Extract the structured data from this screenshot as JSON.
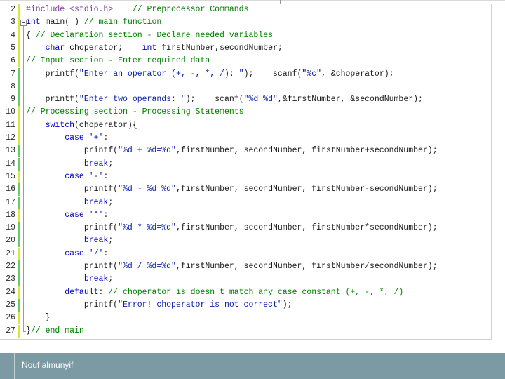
{
  "editor": {
    "lines": [
      {
        "number": "2",
        "gutter": "#d9e63a",
        "tokens": [
          {
            "t": "#include <stdio.h>",
            "c": "pp"
          },
          {
            "t": "    // Preprocessor Commands",
            "c": "cm"
          }
        ]
      },
      {
        "number": "3",
        "gutter": "#d9e63a",
        "tokens": [
          {
            "t": "int",
            "c": "kw"
          },
          {
            "t": " main( ) ",
            "c": "default"
          },
          {
            "t": "// main function",
            "c": "cm"
          }
        ]
      },
      {
        "number": "4",
        "gutter": "#d9e63a",
        "tokens": [
          {
            "t": "{ ",
            "c": "default"
          },
          {
            "t": "// Declaration section - Declare needed variables",
            "c": "cm"
          }
        ]
      },
      {
        "number": "5",
        "gutter": "#d9e63a",
        "tokens": [
          {
            "t": "    ",
            "c": "default"
          },
          {
            "t": "char",
            "c": "kw"
          },
          {
            "t": " choperator;    ",
            "c": "default"
          },
          {
            "t": "int",
            "c": "kw"
          },
          {
            "t": " firstNumber,secondNumber;",
            "c": "default"
          }
        ]
      },
      {
        "number": "6",
        "gutter": "#d9e63a",
        "tokens": [
          {
            "t": "// Input section - Enter required data",
            "c": "cm"
          }
        ]
      },
      {
        "number": "7",
        "gutter": "#66cc66",
        "tokens": [
          {
            "t": "    printf(",
            "c": "default"
          },
          {
            "t": "\"Enter an operator (+, -, *, /): \"",
            "c": "str"
          },
          {
            "t": ");    scanf(",
            "c": "default"
          },
          {
            "t": "\"%c\"",
            "c": "str"
          },
          {
            "t": ", &choperator);",
            "c": "default"
          }
        ]
      },
      {
        "number": "8",
        "gutter": "#66cc66",
        "tokens": []
      },
      {
        "number": "9",
        "gutter": "#66cc66",
        "tokens": [
          {
            "t": "    printf(",
            "c": "default"
          },
          {
            "t": "\"Enter two operands: \"",
            "c": "str"
          },
          {
            "t": ");    scanf(",
            "c": "default"
          },
          {
            "t": "\"%d %d\"",
            "c": "str"
          },
          {
            "t": ",&firstNumber, &secondNumber);",
            "c": "default"
          }
        ]
      },
      {
        "number": "10",
        "gutter": "#d9e63a",
        "tokens": [
          {
            "t": "// Processing section - Processing Statements",
            "c": "cm"
          }
        ]
      },
      {
        "number": "11",
        "gutter": "#d9e63a",
        "tokens": [
          {
            "t": "    ",
            "c": "default"
          },
          {
            "t": "switch",
            "c": "kw"
          },
          {
            "t": "(choperator){",
            "c": "default"
          }
        ]
      },
      {
        "number": "12",
        "gutter": "#d9e63a",
        "tokens": [
          {
            "t": "        ",
            "c": "default"
          },
          {
            "t": "case",
            "c": "kw"
          },
          {
            "t": " ",
            "c": "default"
          },
          {
            "t": "'+'",
            "c": "str"
          },
          {
            "t": ":",
            "c": "default"
          }
        ]
      },
      {
        "number": "13",
        "gutter": "#66cc66",
        "tokens": [
          {
            "t": "            printf(",
            "c": "default"
          },
          {
            "t": "\"%d + %d=%d\"",
            "c": "str"
          },
          {
            "t": ",firstNumber, secondNumber, firstNumber+secondNumber);",
            "c": "default"
          }
        ]
      },
      {
        "number": "14",
        "gutter": "#66cc66",
        "tokens": [
          {
            "t": "            ",
            "c": "default"
          },
          {
            "t": "break",
            "c": "kw"
          },
          {
            "t": ";",
            "c": "default"
          }
        ]
      },
      {
        "number": "15",
        "gutter": "#d9e63a",
        "tokens": [
          {
            "t": "        ",
            "c": "default"
          },
          {
            "t": "case",
            "c": "kw"
          },
          {
            "t": " ",
            "c": "default"
          },
          {
            "t": "'-'",
            "c": "str"
          },
          {
            "t": ":",
            "c": "default"
          }
        ]
      },
      {
        "number": "16",
        "gutter": "#66cc66",
        "tokens": [
          {
            "t": "            printf(",
            "c": "default"
          },
          {
            "t": "\"%d - %d=%d\"",
            "c": "str"
          },
          {
            "t": ",firstNumber, secondNumber, firstNumber-secondNumber);",
            "c": "default"
          }
        ]
      },
      {
        "number": "17",
        "gutter": "#66cc66",
        "tokens": [
          {
            "t": "            ",
            "c": "default"
          },
          {
            "t": "break",
            "c": "kw"
          },
          {
            "t": ";",
            "c": "default"
          }
        ]
      },
      {
        "number": "18",
        "gutter": "#d9e63a",
        "tokens": [
          {
            "t": "        ",
            "c": "default"
          },
          {
            "t": "case",
            "c": "kw"
          },
          {
            "t": " ",
            "c": "default"
          },
          {
            "t": "'*'",
            "c": "str"
          },
          {
            "t": ":",
            "c": "default"
          }
        ]
      },
      {
        "number": "19",
        "gutter": "#66cc66",
        "tokens": [
          {
            "t": "            printf(",
            "c": "default"
          },
          {
            "t": "\"%d * %d=%d\"",
            "c": "str"
          },
          {
            "t": ",firstNumber, secondNumber, firstNumber*secondNumber);",
            "c": "default"
          }
        ]
      },
      {
        "number": "20",
        "gutter": "#66cc66",
        "tokens": [
          {
            "t": "            ",
            "c": "default"
          },
          {
            "t": "break",
            "c": "kw"
          },
          {
            "t": ";",
            "c": "default"
          }
        ]
      },
      {
        "number": "21",
        "gutter": "#d9e63a",
        "tokens": [
          {
            "t": "        ",
            "c": "default"
          },
          {
            "t": "case",
            "c": "kw"
          },
          {
            "t": " ",
            "c": "default"
          },
          {
            "t": "'/'",
            "c": "str"
          },
          {
            "t": ":",
            "c": "default"
          }
        ]
      },
      {
        "number": "22",
        "gutter": "#66cc66",
        "tokens": [
          {
            "t": "            printf(",
            "c": "default"
          },
          {
            "t": "\"%d / %d=%d\"",
            "c": "str"
          },
          {
            "t": ",firstNumber, secondNumber, firstNumber/secondNumber);",
            "c": "default"
          }
        ]
      },
      {
        "number": "23",
        "gutter": "#66cc66",
        "tokens": [
          {
            "t": "            ",
            "c": "default"
          },
          {
            "t": "break",
            "c": "kw"
          },
          {
            "t": ";",
            "c": "default"
          }
        ]
      },
      {
        "number": "24",
        "gutter": "#d9e63a",
        "tokens": [
          {
            "t": "        ",
            "c": "default"
          },
          {
            "t": "default",
            "c": "kw"
          },
          {
            "t": ": ",
            "c": "default"
          },
          {
            "t": "// choperator is doesn't match any case constant (+, -, *, /)",
            "c": "cm"
          }
        ]
      },
      {
        "number": "25",
        "gutter": "#66cc66",
        "tokens": [
          {
            "t": "            printf(",
            "c": "default"
          },
          {
            "t": "\"Error! choperator is not correct\"",
            "c": "str"
          },
          {
            "t": ");",
            "c": "default"
          }
        ]
      },
      {
        "number": "26",
        "gutter": "#d9e63a",
        "tokens": [
          {
            "t": "    }",
            "c": "default"
          }
        ]
      },
      {
        "number": "27",
        "gutter": "#d9e63a",
        "tokens": [
          {
            "t": "}",
            "c": "default"
          },
          {
            "t": "// end main",
            "c": "cm"
          }
        ]
      }
    ],
    "colors": {
      "preprocessor": "#7a3e9d",
      "keyword": "#0000cc",
      "comment": "#008000",
      "string": "#0b22a8",
      "saved_change": "#66cc66",
      "unsaved_change": "#d9e63a"
    }
  },
  "footer": {
    "author": "Nouf almunyif",
    "color": "#7b9aa3"
  }
}
